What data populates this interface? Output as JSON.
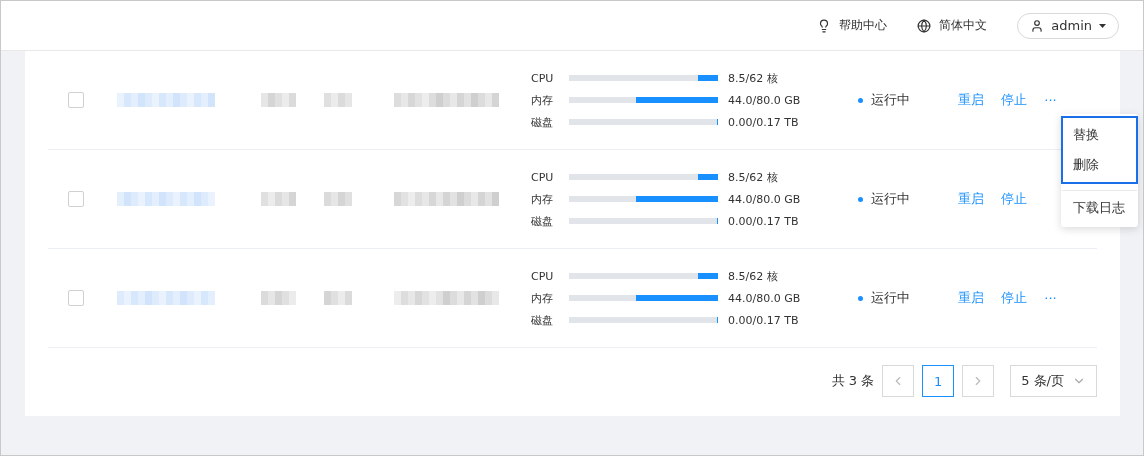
{
  "header": {
    "help": "帮助中心",
    "language": "简体中文",
    "user": "admin"
  },
  "rows": [
    {
      "checked": false,
      "resources": [
        {
          "label": "CPU",
          "level": 0.137,
          "value": "8.5/62 核"
        },
        {
          "label": "内存",
          "level": 0.55,
          "value": "44.0/80.0 GB"
        },
        {
          "label": "磁盘",
          "level": 0.01,
          "value": "0.00/0.17 TB"
        }
      ],
      "status": "运行中",
      "color": "#1890ff",
      "actions": [
        "重启",
        "停止"
      ],
      "more": "···",
      "menu": {
        "sections": [
          {
            "focused": true,
            "items": [
              "替换",
              "删除"
            ]
          },
          {
            "focused": false,
            "items": [
              "下载日志"
            ]
          }
        ]
      }
    },
    {
      "checked": false,
      "resources": [
        {
          "label": "CPU",
          "level": 0.137,
          "value": "8.5/62 核"
        },
        {
          "label": "内存",
          "level": 0.55,
          "value": "44.0/80.0 GB"
        },
        {
          "label": "磁盘",
          "level": 0.01,
          "value": "0.00/0.17 TB"
        }
      ],
      "status": "运行中",
      "color": "#1890ff",
      "actions": [
        "重启",
        "停止"
      ]
    },
    {
      "checked": false,
      "resources": [
        {
          "label": "CPU",
          "level": 0.137,
          "value": "8.5/62 核"
        },
        {
          "label": "内存",
          "level": 0.55,
          "value": "44.0/80.0 GB"
        },
        {
          "label": "磁盘",
          "level": 0.01,
          "value": "0.00/0.17 TB"
        }
      ],
      "status": "运行中",
      "color": "#1890ff",
      "actions": [
        "重启",
        "停止"
      ],
      "more": "···"
    }
  ],
  "pagination": {
    "total": "共 3 条",
    "pages": [
      {
        "label": "1",
        "selected": true
      }
    ],
    "page_size": "5 条/页"
  }
}
